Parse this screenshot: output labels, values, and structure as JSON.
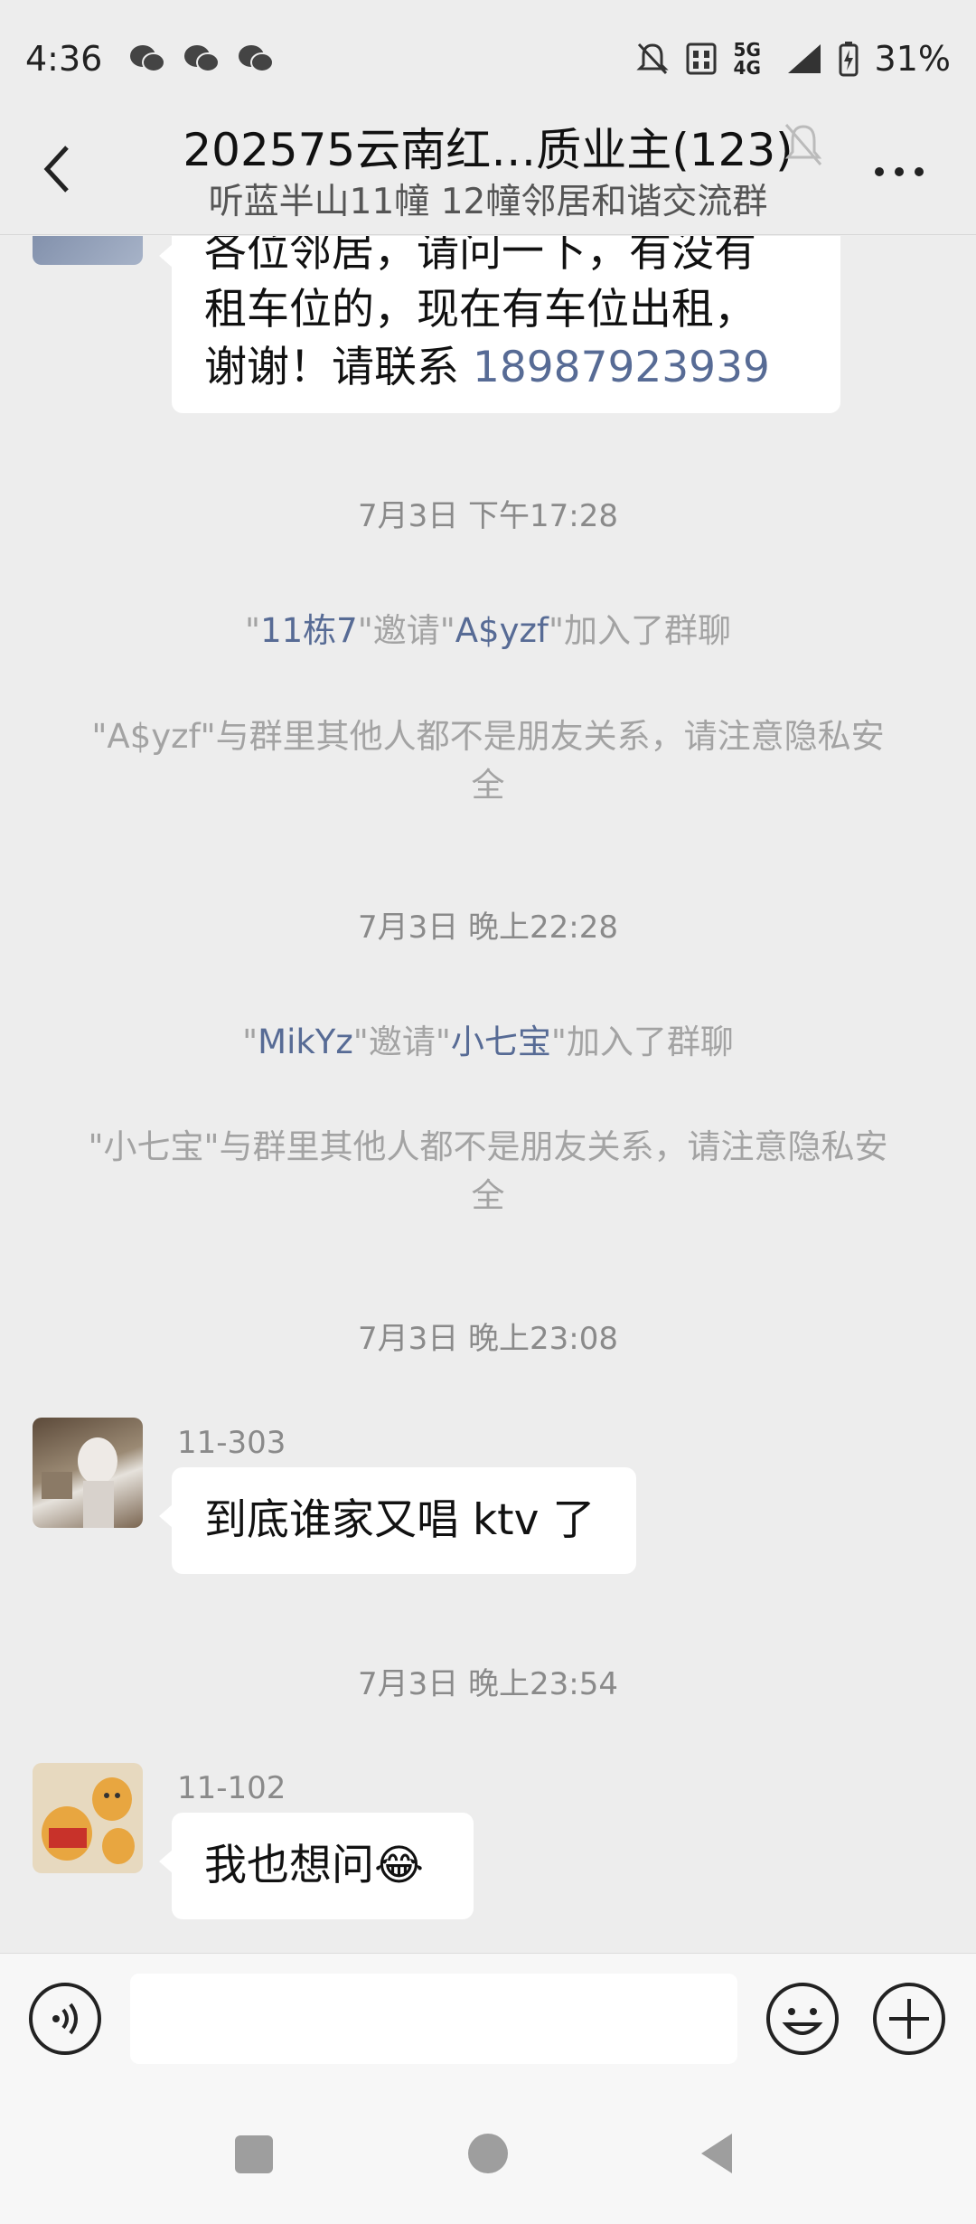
{
  "status_bar": {
    "time": "4:36",
    "network": "5G 4G",
    "battery": "31%"
  },
  "header": {
    "title": "202575云南红…质业主(123)",
    "subtitle": "听蓝半山11幢 12幢邻居和谐交流群"
  },
  "messages": {
    "first": {
      "line1": "各位邻居，请问一下，有没有",
      "line2": "租车位的，现在有车位出租，",
      "line3_prefix": "谢谢！请联系 ",
      "phone": "18987923939"
    },
    "ts1": "7月3日 下午17:28",
    "sys1": {
      "q1": "\"",
      "inviter": "11栋7",
      "mid": "\"邀请\"",
      "invitee": "A$yzf",
      "tail": "\"加入了群聊"
    },
    "warn1": "\"A$yzf\"与群里其他人都不是朋友关系，请注意隐私安全",
    "ts2": "7月3日 晚上22:28",
    "sys2": {
      "q1": "\"",
      "inviter": "MikYz",
      "mid": "\"邀请\"",
      "invitee": "小七宝",
      "tail": "\"加入了群聊"
    },
    "warn2": "\"小七宝\"与群里其他人都不是朋友关系，请注意隐私安全",
    "ts3": "7月3日 晚上23:08",
    "msg2": {
      "sender": "11-303",
      "text": "到底谁家又唱 ktv 了"
    },
    "ts4": "7月3日 晚上23:54",
    "msg3": {
      "sender": "11-102",
      "text": "我也想问",
      "emoji": "😂"
    }
  },
  "colors": {
    "background": "#ededed",
    "link": "#576b95",
    "bubble": "#ffffff"
  },
  "icons": [
    "back-icon",
    "mute-bell-icon",
    "more-icon",
    "voice-icon",
    "emoji-icon",
    "plus-icon"
  ]
}
